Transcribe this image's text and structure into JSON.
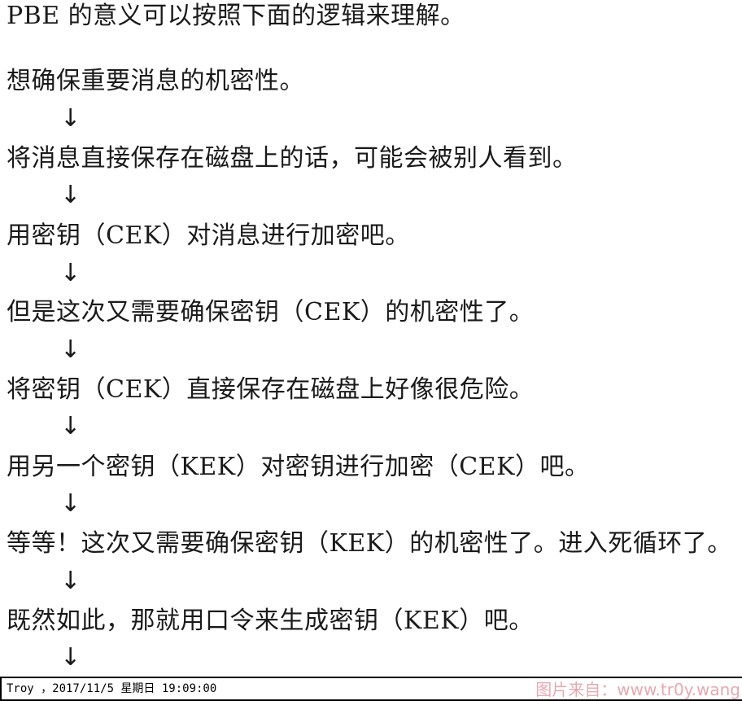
{
  "document": {
    "intro": "PBE 的意义可以按照下面的逻辑来理解。",
    "steps": [
      "想确保重要消息的机密性。",
      "将消息直接保存在磁盘上的话，可能会被别人看到。",
      "用密钥（CEK）对消息进行加密吧。",
      "但是这次又需要确保密钥（CEK）的机密性了。",
      "将密钥（CEK）直接保存在磁盘上好像很危险。",
      "用另一个密钥（KEK）对密钥进行加密（CEK）吧。",
      "等等！这次又需要确保密钥（KEK）的机密性了。进入死循环了。",
      "既然如此，那就用口令来生成密钥（KEK）吧。"
    ],
    "arrow": "↓"
  },
  "footer": {
    "caption": "Troy ，2017/11/5 星期日 19:09:00",
    "watermark": "图片来自：www.tr0y.wang"
  }
}
